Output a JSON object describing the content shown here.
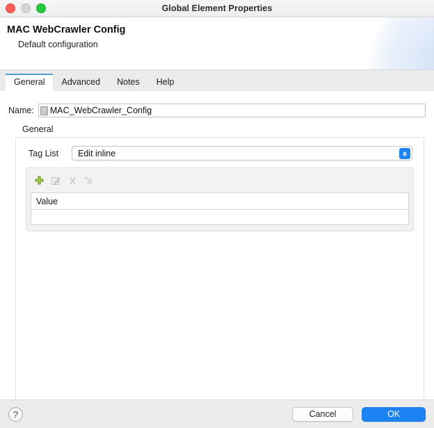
{
  "window": {
    "title": "Global Element Properties",
    "traffic_lights": [
      "close",
      "minimize",
      "zoom"
    ]
  },
  "banner": {
    "title": "MAC WebCrawler Config",
    "subtitle": "Default configuration"
  },
  "tabs": [
    {
      "label": "General",
      "active": true
    },
    {
      "label": "Advanced",
      "active": false
    },
    {
      "label": "Notes",
      "active": false
    },
    {
      "label": "Help",
      "active": false
    }
  ],
  "form": {
    "name_label": "Name:",
    "name_value": "MAC_WebCrawler_Config",
    "name_badge_glyph": "i",
    "group_label": "General",
    "taglist_label": "Tag List",
    "taglist_value": "Edit inline",
    "taglist_options": [
      "Edit inline"
    ]
  },
  "table_toolbar": {
    "add_label": "add-row",
    "edit_label": "edit-row",
    "delete_label": "delete-row",
    "delete_all_label": "delete-all-rows"
  },
  "table": {
    "columns": [
      "Value"
    ],
    "rows": [
      {
        "value": ""
      }
    ]
  },
  "footer": {
    "help_label": "?",
    "cancel_label": "Cancel",
    "ok_label": "OK"
  },
  "colors": {
    "accent": "#1c83f2",
    "tab_active_border": "#4a9eda",
    "add_icon_green": "#8cc63f",
    "close_red": "#ff5f57",
    "minimize_gray": "#d4d4d4",
    "zoom_green": "#28c840"
  }
}
